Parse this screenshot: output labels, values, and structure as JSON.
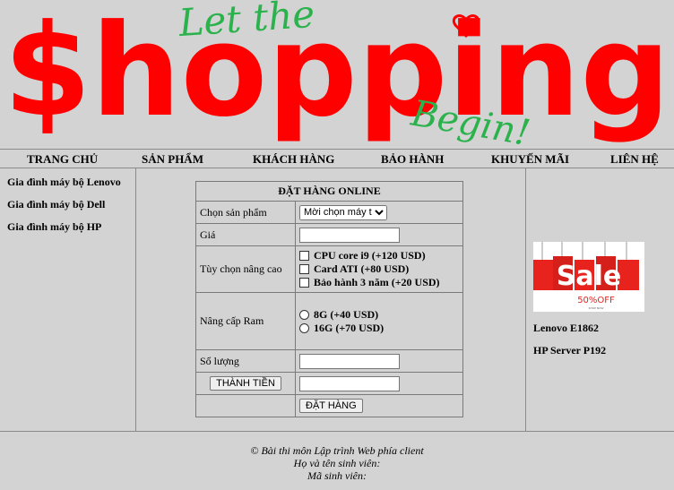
{
  "banner": {
    "script_top": "Let the",
    "main": "$hopping",
    "script_bottom": "Begin!"
  },
  "nav": [
    {
      "label": "TRANG CHỦ"
    },
    {
      "label": "SẢN PHẨM"
    },
    {
      "label": "KHÁCH HÀNG"
    },
    {
      "label": "BẢO HÀNH"
    },
    {
      "label": "KHUYẾN MÃI"
    },
    {
      "label": "LIÊN HỆ"
    }
  ],
  "sidebar": {
    "items": [
      {
        "label": "Gia đình máy bộ Lenovo"
      },
      {
        "label": "Gia đình máy bộ Dell"
      },
      {
        "label": "Gia đình máy bộ HP"
      }
    ]
  },
  "form": {
    "title": "ĐẶT HÀNG ONLINE",
    "product_label": "Chọn sản phẩm",
    "product_selected": "Mời chọn máy tính",
    "price_label": "Giá",
    "price_value": "",
    "options_label": "Tùy chọn nâng cao",
    "options": [
      {
        "label": "CPU core i9 (+120 USD)",
        "checked": false
      },
      {
        "label": "Card ATI (+80 USD)",
        "checked": false
      },
      {
        "label": "Bảo hành 3 năm (+20 USD)",
        "checked": false
      }
    ],
    "ram_label": "Nâng cấp Ram",
    "ram_options": [
      {
        "label": "8G (+40 USD)",
        "selected": false
      },
      {
        "label": "16G (+70 USD)",
        "selected": false
      }
    ],
    "quantity_label": "Số lượng",
    "quantity_value": "",
    "total_button": "THÀNH TIỀN",
    "total_value": "",
    "order_button": "ĐẶT HÀNG"
  },
  "right": {
    "sale_text": "Sale",
    "sale_sub": "50%OFF",
    "sale_tiny": "SHOP NOW",
    "products": [
      {
        "label": "Lenovo E1862"
      },
      {
        "label": "HP Server P192"
      }
    ]
  },
  "footer": {
    "line1": "© Bài thi môn Lập trình Web phía client",
    "line2": "Họ và tên sinh viên:",
    "line3": "Mã sinh viên:"
  },
  "colors": {
    "background": "#d3d3d3",
    "banner_red": "#ff0000",
    "banner_green": "#2bb24c"
  }
}
